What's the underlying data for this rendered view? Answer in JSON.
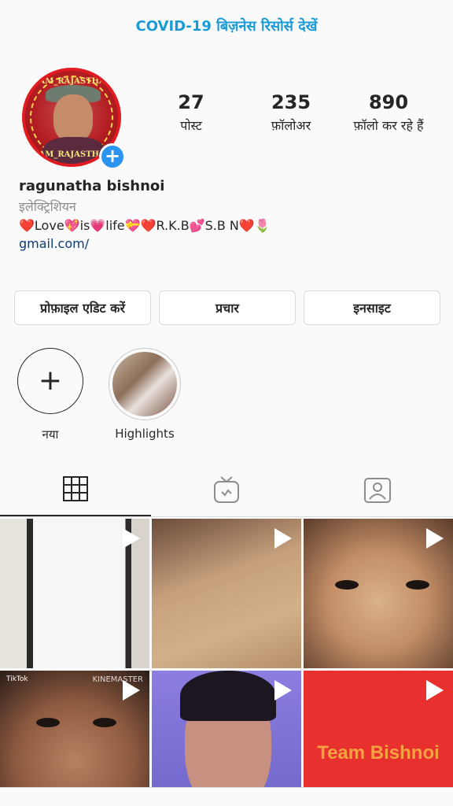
{
  "banner": {
    "text": "COVID-19 बिज़नेस रिसोर्स देखें"
  },
  "avatar": {
    "top_text": "TEAM_RAJASTHANI",
    "bottom_text": "TEAM_RAJASTHANI"
  },
  "stats": [
    {
      "value": "27",
      "label": "पोस्ट"
    },
    {
      "value": "235",
      "label": "फ़ॉलोअर"
    },
    {
      "value": "890",
      "label": "फ़ॉलो कर रहे हैं"
    }
  ],
  "bio": {
    "name": "ragunatha bishnoi",
    "category": "इलेक्ट्रिशियन",
    "text": "❤️Love💖is💗life💝❤️R.K.B💕S.B N❤️🌷",
    "link": "gmail.com/"
  },
  "buttons": {
    "edit": "प्रोफ़ाइल एडिट करें",
    "promote": "प्रचार",
    "insights": "इनसाइट"
  },
  "highlights": {
    "new_label": "नया",
    "highlight_label": "Highlights"
  },
  "posts": {
    "team_text": "Team Bishnoi",
    "tiktok_caption": "TikTok",
    "kine_caption": "KINEMASTER"
  }
}
